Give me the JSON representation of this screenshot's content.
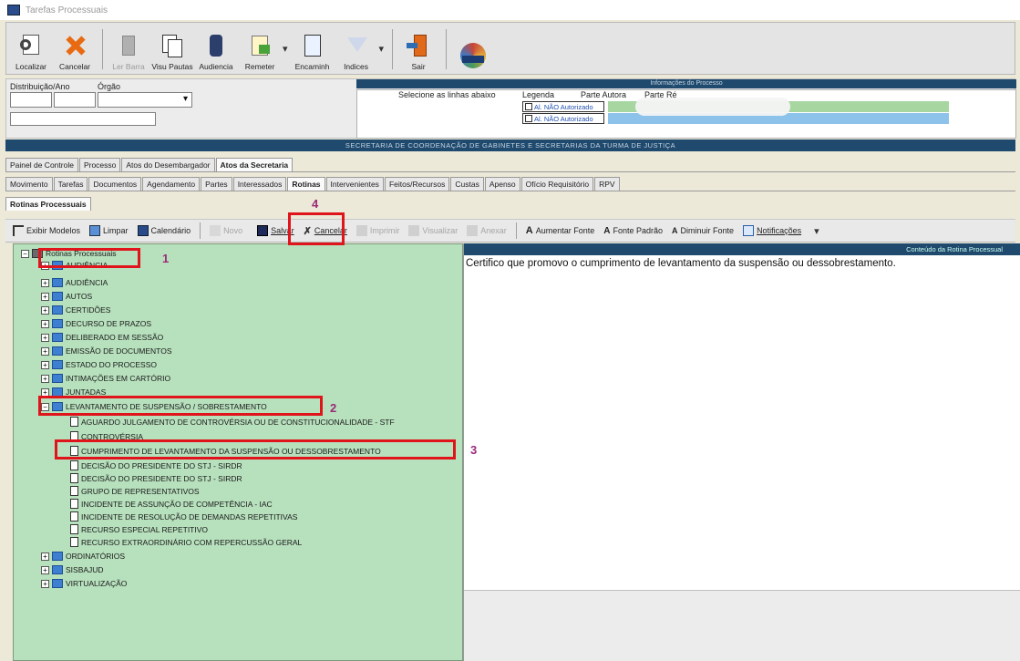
{
  "window": {
    "title": "Tarefas Processuais"
  },
  "toolbar": {
    "buttons": [
      {
        "label": "Localizar",
        "enabled": true
      },
      {
        "label": "Cancelar",
        "enabled": true
      },
      {
        "label": "Ler Barra",
        "enabled": false
      },
      {
        "label": "Visu Pautas",
        "enabled": true
      },
      {
        "label": "Audiencia",
        "enabled": true
      },
      {
        "label": "Remeter",
        "enabled": true
      },
      {
        "label": "Encaminh",
        "enabled": true
      },
      {
        "label": "Indices",
        "enabled": true
      },
      {
        "label": "Sair",
        "enabled": true
      },
      {
        "label": "",
        "enabled": true
      }
    ]
  },
  "filter": {
    "distribuicao_label": "Distribuição/Ano",
    "orgao_label": "Órgão",
    "right_header": "Informações do Processo",
    "select_label": "Selecione as linhas abaixo",
    "legenda_label": "Legenda",
    "parte_autora": "Parte Autora",
    "parte_re": "Parte Ré",
    "legend_items": [
      "Al. NÃO Autorizado",
      "Al. NÃO Autorizado"
    ],
    "colors": {
      "legend_green": "#a7d6a1",
      "legend_blue": "#8dc3ea"
    }
  },
  "darkbar": {
    "text": "SECRETARIA DE COORDENAÇÃO DE GABINETES E SECRETARIAS DA TURMA DE JUSTIÇA"
  },
  "tabs_row1": [
    {
      "label": "Painel de Controle",
      "active": false
    },
    {
      "label": "Processo",
      "active": false
    },
    {
      "label": "Atos do Desembargador",
      "active": false
    },
    {
      "label": "Atos da Secretaria",
      "active": true
    }
  ],
  "tabs_row2": [
    {
      "label": "Movimento",
      "active": false
    },
    {
      "label": "Tarefas",
      "active": false
    },
    {
      "label": "Documentos",
      "active": false
    },
    {
      "label": "Agendamento",
      "active": false
    },
    {
      "label": "Partes",
      "active": false
    },
    {
      "label": "Interessados",
      "active": false
    },
    {
      "label": "Rotinas",
      "active": true
    },
    {
      "label": "Intervenientes",
      "active": false
    },
    {
      "label": "Feitos/Recursos",
      "active": false
    },
    {
      "label": "Custas",
      "active": false
    },
    {
      "label": "Apenso",
      "active": false
    },
    {
      "label": "Ofício Requisitório",
      "active": false
    },
    {
      "label": "RPV",
      "active": false
    }
  ],
  "tabs_row3": [
    {
      "label": "Rotinas Processuais",
      "active": true
    }
  ],
  "actions": [
    {
      "label": "Exibir Modelos",
      "enabled": true
    },
    {
      "label": "Limpar",
      "enabled": true
    },
    {
      "label": "Calendário",
      "enabled": true
    },
    {
      "label": "Novo",
      "enabled": false
    },
    {
      "label": "Salvar",
      "enabled": true
    },
    {
      "label": "Cancelar",
      "enabled": true
    },
    {
      "label": "Imprimir",
      "enabled": false
    },
    {
      "label": "Visualizar",
      "enabled": false
    },
    {
      "label": "Anexar",
      "enabled": false
    },
    {
      "label": "Aumentar Fonte",
      "enabled": true
    },
    {
      "label": "Fonte Padrão",
      "enabled": true
    },
    {
      "label": "Diminuir Fonte",
      "enabled": true
    },
    {
      "label": "Notificações",
      "enabled": true
    }
  ],
  "tree": {
    "root": "Rotinas Processuais",
    "items": [
      "AUDIÊNCIA",
      "AUTOS",
      "CERTIDÕES",
      "DECURSO DE PRAZOS",
      "DELIBERADO EM SESSÃO",
      "EMISSÃO DE DOCUMENTOS",
      "ESTADO DO PROCESSO",
      "INTIMAÇÕES EM CARTÓRIO",
      "JUNTADAS",
      "LEVANTAMENTO DE SUSPENSÃO / SOBRESTAMENTO",
      "AGUARDO JULGAMENTO DE CONTROVÉRSIA OU DE CONSTITUCIONALIDADE - STF",
      "CONTROVÉRSIA",
      "CUMPRIMENTO DE LEVANTAMENTO DA SUSPENSÃO OU DESSOBRESTAMENTO",
      "DECISÃO DO PRESIDENTE DO STJ - SIRDR",
      "DECISÃO DO PRESIDENTE DO STJ - SIRDR",
      "GRUPO DE REPRESENTATIVOS",
      "INCIDENTE DE ASSUNÇÃO DE COMPETÊNCIA - IAC",
      "INCIDENTE DE RESOLUÇÃO DE DEMANDAS REPETITIVAS",
      "RECURSO ESPECIAL REPETITIVO",
      "RECURSO EXTRAORDINÁRIO COM REPERCUSSÃO GERAL",
      "ORDINATÓRIOS",
      "SISBAJUD",
      "VIRTUALIZAÇÃO"
    ]
  },
  "content": {
    "header": "Conteúdo da Rotina Processual",
    "text": "Certifico que promovo o cumprimento de levantamento da suspensão ou dessobrestamento."
  },
  "annotations": [
    "1",
    "2",
    "3",
    "4"
  ]
}
